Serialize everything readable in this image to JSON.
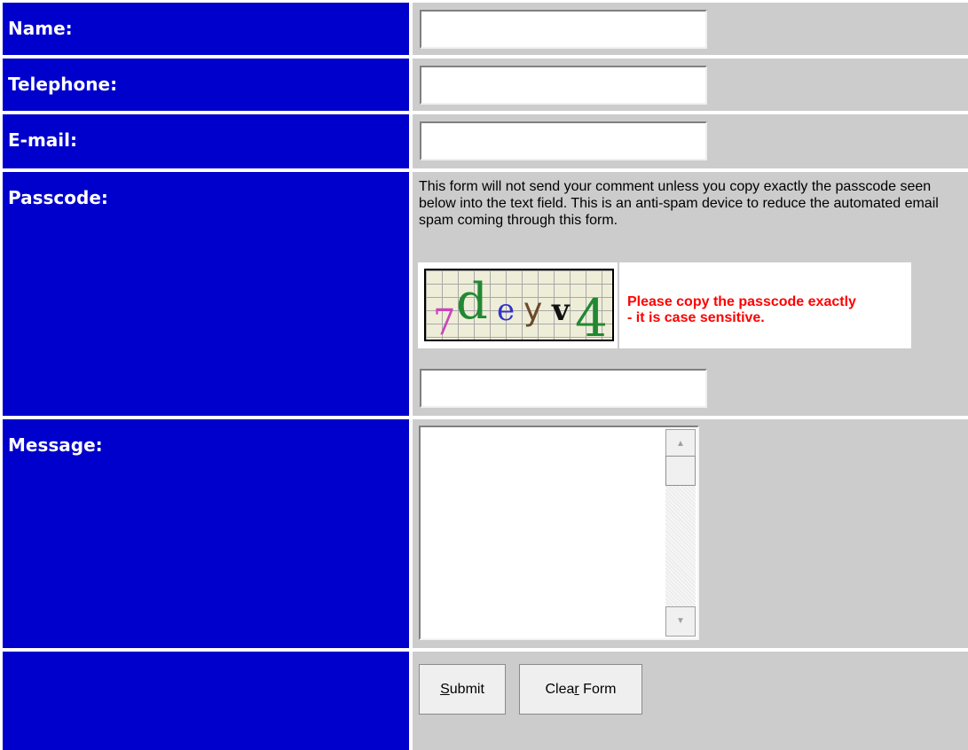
{
  "form": {
    "name": {
      "label": "Name:",
      "value": ""
    },
    "telephone": {
      "label": "Telephone:",
      "value": ""
    },
    "email": {
      "label": "E-mail:",
      "value": ""
    },
    "passcode": {
      "label": "Passcode:",
      "info": "This form will not send your comment unless you copy exactly the passcode seen below into the text field. This is an anti-spam device to reduce the automated email spam coming through this form.",
      "captcha_text": "7deyv4",
      "captcha_chars": [
        {
          "char": "7",
          "color": "#cc44bb"
        },
        {
          "char": "d",
          "color": "#228833"
        },
        {
          "char": "e",
          "color": "#3333cc"
        },
        {
          "char": "y",
          "color": "#6b4a2a"
        },
        {
          "char": "v",
          "color": "#111111"
        },
        {
          "char": "4",
          "color": "#228833"
        }
      ],
      "note_line1": "Please copy the passcode exactly",
      "note_line2": "- it is case sensitive.",
      "value": ""
    },
    "message": {
      "label": "Message:",
      "value": ""
    },
    "submit": {
      "accesskey": "S",
      "rest": "ubmit"
    },
    "clear": {
      "before": "Clea",
      "accesskey": "r",
      "after": " Form"
    }
  },
  "colors": {
    "label_bg": "#0000cc",
    "label_text": "#ffffff",
    "field_bg": "#cccccc",
    "note_text": "#ff0000"
  }
}
